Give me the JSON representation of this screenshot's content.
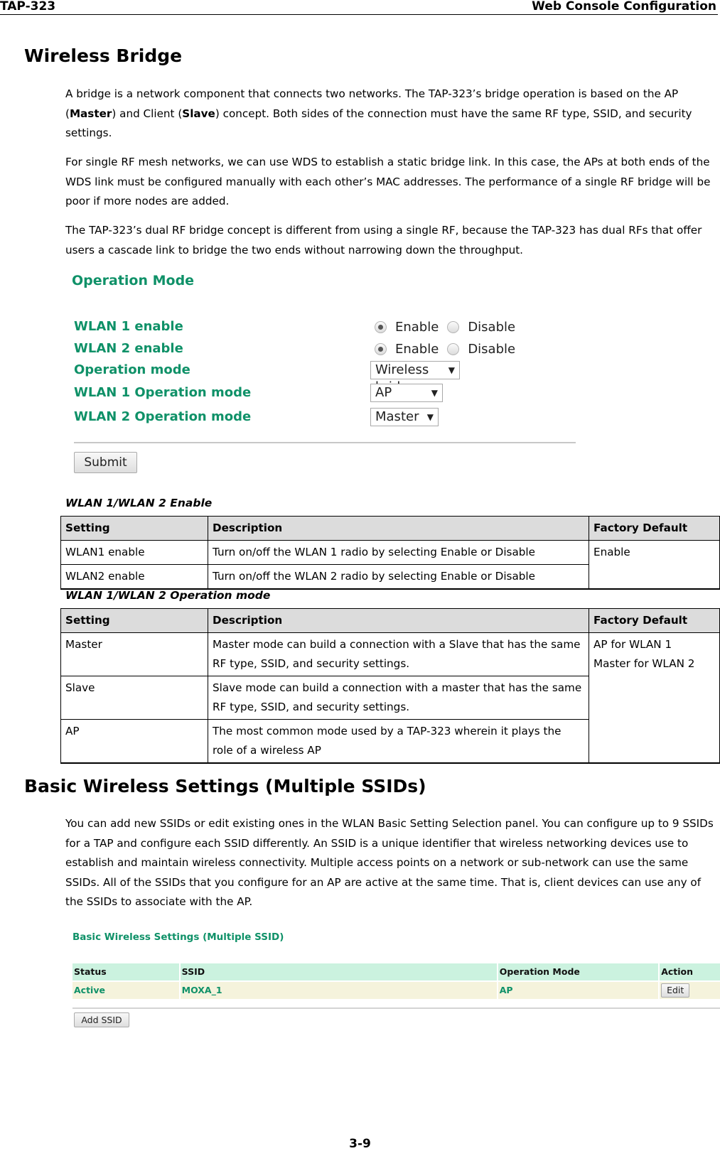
{
  "header": {
    "left": "TAP-323",
    "right": "Web Console Configuration"
  },
  "section1": {
    "title": "Wireless Bridge",
    "paragraphs": {
      "p1_a": "A bridge is a network component that connects two networks. The TAP-323’s bridge operation is based on the AP (",
      "p1_master": "Master",
      "p1_b": ") and Client (",
      "p1_slave": "Slave",
      "p1_c": ") concept. Both sides of the connection must have the same RF type, SSID, and security settings.",
      "p2": "For single RF mesh networks, we can use WDS to establish a static bridge link. In this case, the APs at both ends of the WDS link must be configured manually with each other’s MAC addresses. The performance of a single RF bridge will be poor if more nodes are added.",
      "p3": "The TAP-323’s dual RF bridge concept is different from using a single RF, because the TAP-323 has dual RFs that offer users a cascade link to bridge the two ends without narrowing down the throughput."
    }
  },
  "operation_mode_panel": {
    "title": "Operation Mode",
    "rows": [
      {
        "label": "WLAN 1 enable",
        "options": [
          "Enable",
          "Disable"
        ],
        "selected": "Enable"
      },
      {
        "label": "WLAN 2 enable",
        "options": [
          "Enable",
          "Disable"
        ],
        "selected": "Enable"
      },
      {
        "label": "Operation mode",
        "value": "Wireless bridge"
      },
      {
        "label": "WLAN 1 Operation mode",
        "value": "AP"
      },
      {
        "label": "WLAN 2 Operation mode",
        "value": "Master"
      }
    ],
    "submit_label": "Submit",
    "accent_color": "#0f9168"
  },
  "table_enable": {
    "caption": "WLAN 1/WLAN 2 Enable",
    "headers": [
      "Setting",
      "Description",
      "Factory Default"
    ],
    "rows": [
      [
        "WLAN1 enable",
        "Turn on/off the WLAN 1 radio by selecting Enable or Disable"
      ],
      [
        "WLAN2 enable",
        "Turn on/off the WLAN 2 radio by selecting Enable or Disable"
      ]
    ],
    "default": "Enable"
  },
  "table_opmode": {
    "caption": "WLAN 1/WLAN 2 Operation mode",
    "headers": [
      "Setting",
      "Description",
      "Factory Default"
    ],
    "rows": [
      [
        "Master",
        "Master mode can build a connection with a Slave that has the same RF type, SSID, and security settings."
      ],
      [
        "Slave",
        "Slave mode can build a connection with a master that has the same RF type, SSID, and security settings."
      ],
      [
        "AP",
        "The most common mode used by a TAP-323 wherein it plays the role of a wireless AP"
      ]
    ],
    "default_line1": "AP for WLAN 1",
    "default_line2": "Master for WLAN 2"
  },
  "section2": {
    "title": "Basic Wireless Settings (Multiple SSIDs)",
    "paragraph": "You can add new SSIDs or edit existing ones in the WLAN Basic Setting Selection panel. You can configure up to 9 SSIDs for a TAP and configure each SSID differently. An SSID is a unique identifier that wireless networking devices use to establish and maintain wireless connectivity. Multiple access points on a network or sub-network can use the same SSIDs. All of the SSIDs that you configure for an AP are active at the same time. That is, client devices can use any of the SSIDs to associate with the AP."
  },
  "ssid_panel": {
    "title": "Basic Wireless Settings (Multiple SSID)",
    "headers": [
      "Status",
      "SSID",
      "Operation Mode",
      "Action"
    ],
    "rows": [
      {
        "status": "Active",
        "ssid": "MOXA_1",
        "mode": "AP",
        "action": "Edit"
      }
    ],
    "add_label": "Add SSID",
    "header_bg": "#cbf2df",
    "row_bg": "#f5f3dc"
  },
  "footer": {
    "page": "3-9"
  }
}
